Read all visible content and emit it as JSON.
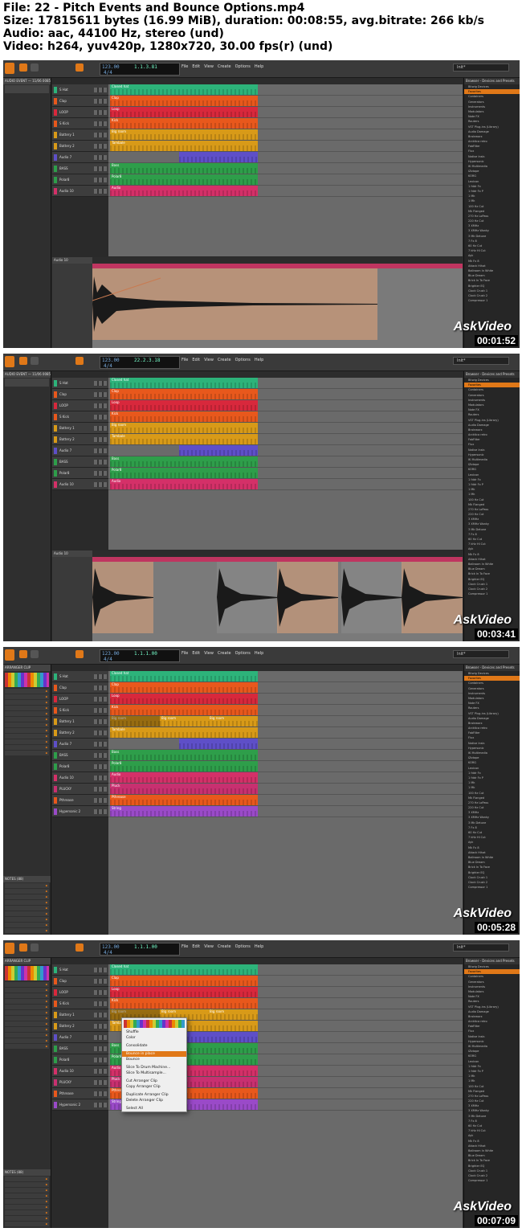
{
  "header": {
    "file": "File: 22 - Pitch Events and Bounce Options.mp4",
    "size": "Size: 17815611 bytes (16.99 MiB), duration: 00:08:55, avg.bitrate: 266 kb/s",
    "audio": "Audio: aac, 44100 Hz, stereo (und)",
    "video": "Video: h264, yuv420p, 1280x720, 30.00 fps(r) (und)"
  },
  "daw": {
    "menu": [
      "File",
      "Edit",
      "View",
      "Create",
      "Options",
      "Help"
    ],
    "tempo": "123.00",
    "signature": "4/4",
    "project": "Init*",
    "tracks": [
      "S Hat",
      "Clap",
      "LOOP",
      "S Kick",
      "Battery 1",
      "Battery 2",
      "Audio 7",
      "BASS",
      "Polar8",
      "Audio 10",
      "PLUCKY",
      "Pthrease",
      "Hypersonic 2"
    ],
    "track_colors": [
      "#2db37a",
      "#e8581c",
      "#d8283c",
      "#e8581c",
      "#d89a18",
      "#d89a18",
      "#5e4fc8",
      "#2e9e4a",
      "#2e9e4a",
      "#d43068",
      "#c83070",
      "#e8581c",
      "#9a4ac8"
    ],
    "clip_labels": [
      "Closed hat",
      "Clap",
      "Loop",
      "Kick",
      "Big room",
      "Tambale",
      "",
      "Bass",
      "Polar8",
      "Audio",
      "Pluck",
      "Pthrease",
      "String"
    ],
    "browser_title": "Browser - Devices and Presets",
    "browser_items": [
      "Bitwig Devices",
      "Favorites",
      "Containers",
      "Generators",
      "Instruments",
      "Modulators",
      "Note FX",
      "Routers",
      "VST Plug-ins (Library)",
      "Audio Damage",
      "Brainworx",
      "Arcktica retro",
      "FabFilter",
      "Flux",
      "Native Instr.",
      "Hypersonic",
      "IK Multimedia",
      "IZotope",
      "KORG",
      "Lexicon",
      "1 fddr Fx",
      "1 fddr Fx P",
      "1 Mk",
      "1 Mk",
      "100 Hz Cut",
      "Mk Flanged",
      "270 Hz LoPass",
      "220 Hz Cut",
      "3 XMHz",
      "3 XMHz Wonky",
      "3 Mk Detune",
      "7 Fx 8",
      "60 Hz Cut",
      "7 kHz Hi Cut",
      "Ayk",
      "Mk Fx 8",
      "Attack Hihat",
      "Ballroom In White",
      "Blue Dream",
      "Brick In To Face",
      "Brighter EQ",
      "Clock Crush 1",
      "Clock Crush 2",
      "Compressor 1"
    ],
    "edit_track": "Audio 10",
    "context_menu": [
      "Shuffle",
      "Color",
      "Consolidate",
      "Bounce in place",
      "Bounce",
      "Slice To Drum Machine...",
      "Slice To Multisample...",
      "Cut Arranger Clip",
      "Copy Arranger Clip",
      "Duplicate Arranger Clip",
      "Delete Arranger Clip",
      "Select All"
    ],
    "inspector_1": "AUDIO EVENT — 11/06 0085",
    "inspector_2": "ARRANGER CLIP",
    "inspector_notes": "NOTES (88)"
  },
  "frames": [
    {
      "time": "00:01:52",
      "position": "1.1.3.81",
      "view": "edit-single"
    },
    {
      "time": "00:03:41",
      "position": "22.2.3.18",
      "view": "edit-multi"
    },
    {
      "time": "00:05:28",
      "position": "1.1.1.00",
      "view": "arrange"
    },
    {
      "time": "00:07:09",
      "position": "1.1.1.00",
      "view": "arrange-menu"
    }
  ],
  "watermark": "AskVideo"
}
